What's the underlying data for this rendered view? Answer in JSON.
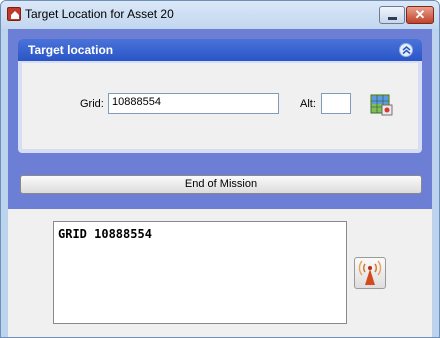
{
  "window": {
    "title": "Target Location for Asset 20",
    "minimize_glyph": "",
    "close_glyph": "✕"
  },
  "panel": {
    "title": "Target location",
    "grid_label": "Grid:",
    "grid_value": "10888554",
    "alt_label": "Alt:",
    "alt_value": ""
  },
  "actions": {
    "end_mission_label": "End of Mission"
  },
  "message": {
    "text": "GRID 10888554"
  },
  "icons": {
    "app": "app-icon",
    "collapse": "double-chevron-up-icon",
    "map": "map-grid-icon",
    "send": "radio-tower-icon"
  },
  "colors": {
    "accent": "#2a55c6",
    "panel_background": "#6c7fd4"
  }
}
